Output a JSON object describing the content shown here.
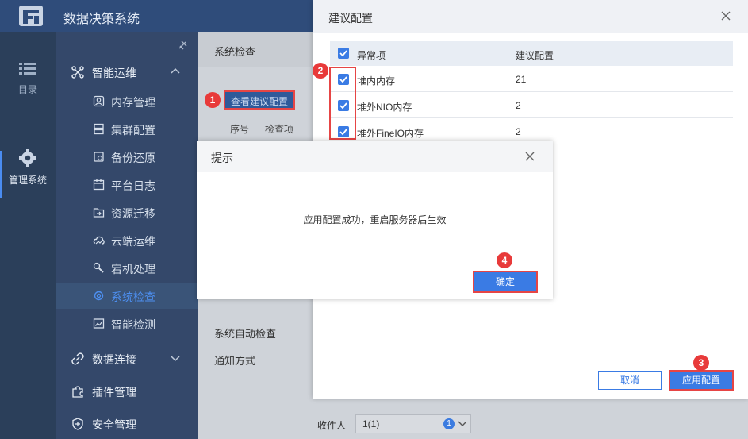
{
  "app": {
    "title": "数据决策系统"
  },
  "rail": [
    {
      "label": "目录",
      "icon": "list-icon"
    },
    {
      "label": "管理系统",
      "icon": "gear-icon"
    }
  ],
  "nav": {
    "groups": [
      {
        "label": "智能运维",
        "icon": "cluster-icon"
      },
      {
        "label": "数据连接",
        "icon": "link-icon"
      },
      {
        "label": "插件管理",
        "icon": "puzzle-icon"
      },
      {
        "label": "安全管理",
        "icon": "shield-icon"
      }
    ],
    "sub": [
      {
        "label": "内存管理"
      },
      {
        "label": "集群配置"
      },
      {
        "label": "备份还原"
      },
      {
        "label": "平台日志"
      },
      {
        "label": "资源迁移"
      },
      {
        "label": "云端运维"
      },
      {
        "label": "宕机处理"
      },
      {
        "label": "系统检查"
      },
      {
        "label": "智能检测"
      }
    ]
  },
  "main": {
    "breadcrumb": "系统检查",
    "view_button": "查看建议配置",
    "table_headers": [
      "序号",
      "检查项"
    ],
    "auto_check_label": "系统自动检查",
    "notify_label": "通知方式",
    "receiver_label": "收件人",
    "receiver_value": "1(1)",
    "receiver_count": "1"
  },
  "config_dialog": {
    "title": "建议配置",
    "columns": [
      "异常项",
      "建议配置"
    ],
    "rows": [
      {
        "item": "堆内内存",
        "value": "21"
      },
      {
        "item": "堆外NIO内存",
        "value": "2"
      },
      {
        "item": "堆外FineIO内存",
        "value": "2"
      }
    ],
    "cancel": "取消",
    "apply": "应用配置"
  },
  "prompt_dialog": {
    "title": "提示",
    "message": "应用配置成功，重启服务器后生效",
    "ok": "确定"
  },
  "steps": [
    "1",
    "2",
    "3",
    "4"
  ],
  "colors": {
    "topbar": "#2f4c7a",
    "nav": "#34486a",
    "accent": "#3a7be4",
    "marker": "#e83a3a"
  }
}
